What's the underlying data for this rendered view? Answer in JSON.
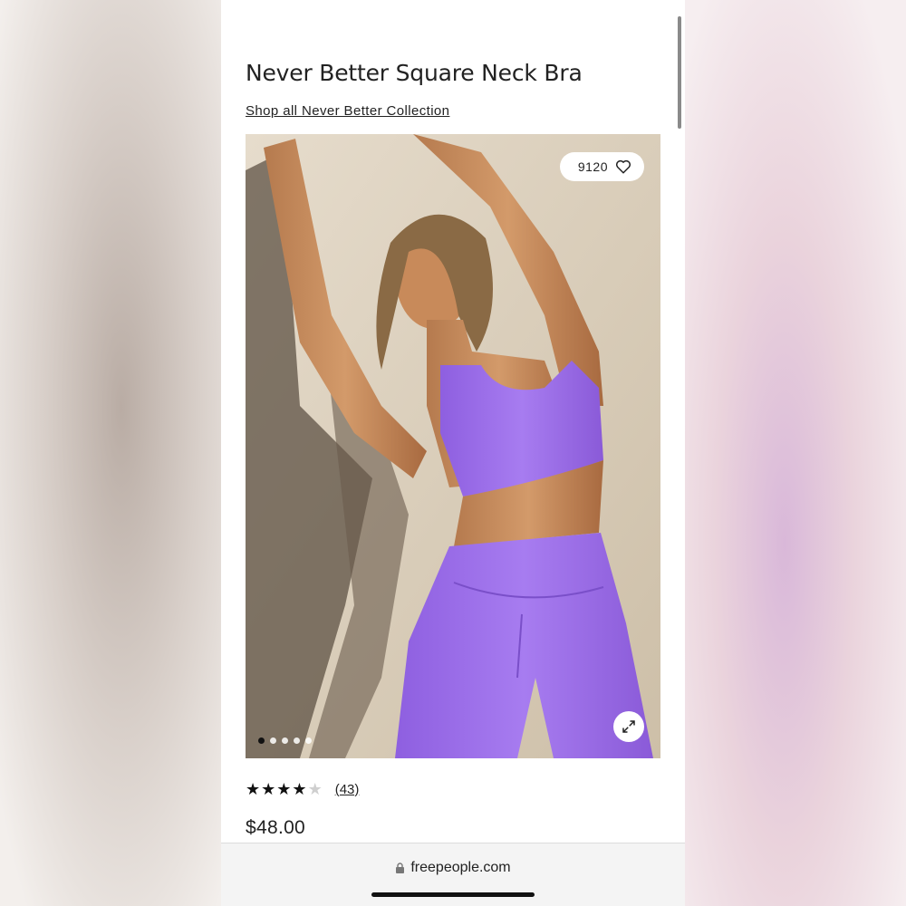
{
  "product": {
    "title": "Never Better Square Neck Bra",
    "collection_link": "Shop all Never Better Collection",
    "favorites_count": "9120",
    "rating_stars": 4,
    "rating_max": 5,
    "review_count": "(43)",
    "price": "$48.00",
    "gallery_images": 5,
    "gallery_active_index": 0
  },
  "browser": {
    "url": "freepeople.com"
  },
  "colors": {
    "accent_purple": "#9b6ee6",
    "text": "#222222"
  },
  "icons": {
    "favorite": "heart-icon",
    "expand": "expand-arrows-icon",
    "secure": "lock-icon"
  }
}
